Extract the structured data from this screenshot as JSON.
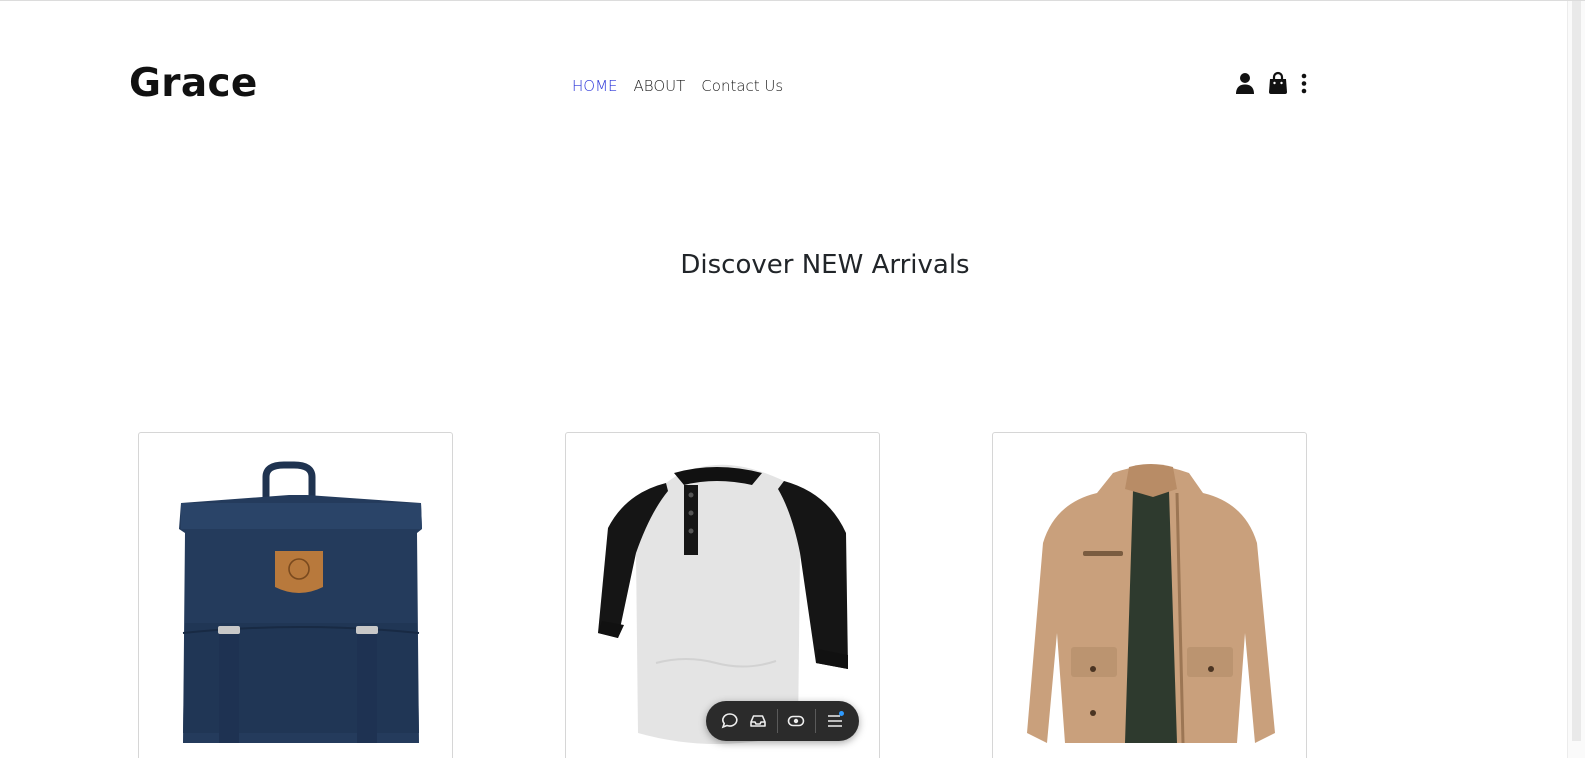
{
  "brand": {
    "name": "Grace"
  },
  "nav": {
    "items": [
      {
        "label": "HOME",
        "active": true
      },
      {
        "label": "ABOUT",
        "active": false
      },
      {
        "label": "Contact Us",
        "active": false
      }
    ],
    "active_color": "#2b35d8"
  },
  "header_icons": [
    "user-icon",
    "shopping-bag-icon",
    "more-vertical-icon"
  ],
  "hero": {
    "headline": "Discover NEW Arrivals"
  },
  "products": [
    {
      "image": "navy-backpack"
    },
    {
      "image": "black-grey-raglan-henley-shirt"
    },
    {
      "image": "khaki-field-jacket"
    }
  ],
  "floating_toolbar": {
    "icons": [
      "chat-bubble-icon",
      "inbox-tray-icon",
      "eye-capsule-icon",
      "menu-list-icon"
    ],
    "notification_dot_color": "#2f9bff"
  }
}
